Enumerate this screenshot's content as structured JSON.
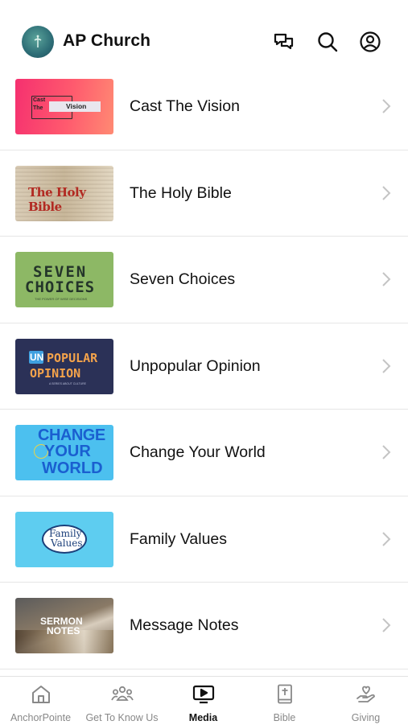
{
  "header": {
    "title": "AP Church",
    "icons": [
      "chat-icon",
      "search-icon",
      "account-icon"
    ]
  },
  "media_list": [
    {
      "label": "Cast The Vision",
      "thumb_text": [
        "Cast",
        "The",
        "Vision"
      ]
    },
    {
      "label": "The Holy Bible",
      "thumb_text": [
        "The Holy Bible"
      ]
    },
    {
      "label": "Seven Choices",
      "thumb_text": [
        "SEVEN",
        "CHOICES",
        "THE POWER OF WISE DECISIONS"
      ]
    },
    {
      "label": "Unpopular Opinion",
      "thumb_text": [
        "UN",
        "POPULAR",
        "OPINION",
        "A SERIES ABOUT CULTURE"
      ]
    },
    {
      "label": "Change Your World",
      "thumb_text": [
        "CHANGE",
        "YOUR",
        "WORLD"
      ]
    },
    {
      "label": "Family Values",
      "thumb_text": [
        "Family",
        "Values"
      ]
    },
    {
      "label": "Message Notes",
      "thumb_text": [
        "SERMON",
        "NOTES"
      ]
    }
  ],
  "tabs": [
    {
      "label": "AnchorPointe",
      "icon": "home-icon",
      "active": false
    },
    {
      "label": "Get To Know Us",
      "icon": "people-icon",
      "active": false
    },
    {
      "label": "Media",
      "icon": "tv-play-icon",
      "active": true
    },
    {
      "label": "Bible",
      "icon": "bible-icon",
      "active": false
    },
    {
      "label": "Giving",
      "icon": "giving-hand-icon",
      "active": false
    }
  ]
}
